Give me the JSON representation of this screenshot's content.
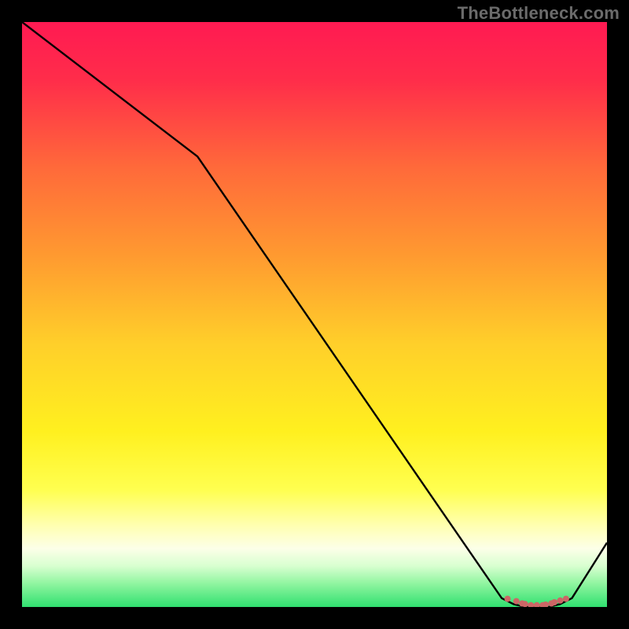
{
  "watermark": "TheBottleneck.com",
  "chart_data": {
    "type": "line",
    "title": "",
    "xlabel": "",
    "ylabel": "",
    "xlim": [
      0,
      100
    ],
    "ylim": [
      0,
      100
    ],
    "series": [
      {
        "name": "curve",
        "x": [
          0,
          30,
          82,
          84,
          86,
          88,
          90,
          92,
          94,
          100
        ],
        "values": [
          100,
          77,
          1.5,
          0.5,
          0,
          0,
          0,
          0.5,
          1.5,
          11
        ]
      }
    ],
    "markers": {
      "name": "bottom-cluster",
      "x": [
        83,
        84.5,
        85.5,
        86,
        87,
        88,
        89,
        89.5,
        90.5,
        91,
        92,
        93
      ],
      "values": [
        1.4,
        1.0,
        0.6,
        0.5,
        0.3,
        0.3,
        0.3,
        0.4,
        0.6,
        0.8,
        1.1,
        1.4
      ],
      "color": "#cc6666"
    },
    "gradient_stops": [
      {
        "offset": 0.0,
        "color": "#ff1a52"
      },
      {
        "offset": 0.1,
        "color": "#ff2d4a"
      },
      {
        "offset": 0.25,
        "color": "#ff6a3a"
      },
      {
        "offset": 0.4,
        "color": "#ff9a30"
      },
      {
        "offset": 0.55,
        "color": "#ffcf2a"
      },
      {
        "offset": 0.7,
        "color": "#fff01f"
      },
      {
        "offset": 0.8,
        "color": "#ffff50"
      },
      {
        "offset": 0.86,
        "color": "#ffffb0"
      },
      {
        "offset": 0.9,
        "color": "#fcffe8"
      },
      {
        "offset": 0.93,
        "color": "#d8ffd0"
      },
      {
        "offset": 0.96,
        "color": "#90f5a0"
      },
      {
        "offset": 1.0,
        "color": "#30e070"
      }
    ]
  }
}
